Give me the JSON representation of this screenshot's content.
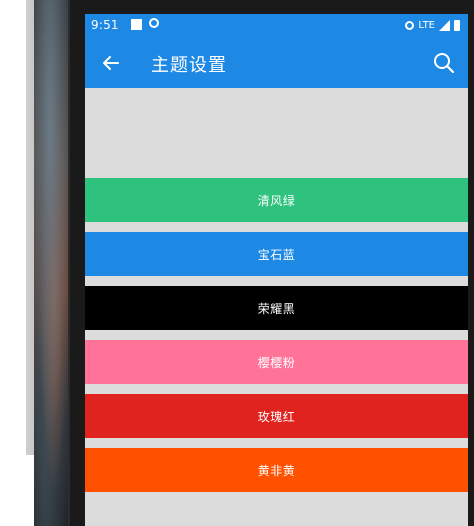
{
  "status_bar": {
    "time": "9:51",
    "network": "LTE",
    "icons": [
      "notification-square-icon",
      "sync-icon",
      "hotspot-icon",
      "signal-icon",
      "battery-icon"
    ]
  },
  "app_bar": {
    "title": "主题设置",
    "back_icon": "arrow-left-icon",
    "search_icon": "search-icon",
    "color": "#1e88e5"
  },
  "themes": [
    {
      "label": "清风绿",
      "color": "#2ec27e"
    },
    {
      "label": "宝石蓝",
      "color": "#1e88e5"
    },
    {
      "label": "荣耀黑",
      "color": "#000000"
    },
    {
      "label": "樱樱粉",
      "color": "#ff7399"
    },
    {
      "label": "玫瑰红",
      "color": "#e0231f"
    },
    {
      "label": "黄非黄",
      "color": "#ff5100"
    }
  ],
  "colors": {
    "background": "#dcdcdc"
  }
}
